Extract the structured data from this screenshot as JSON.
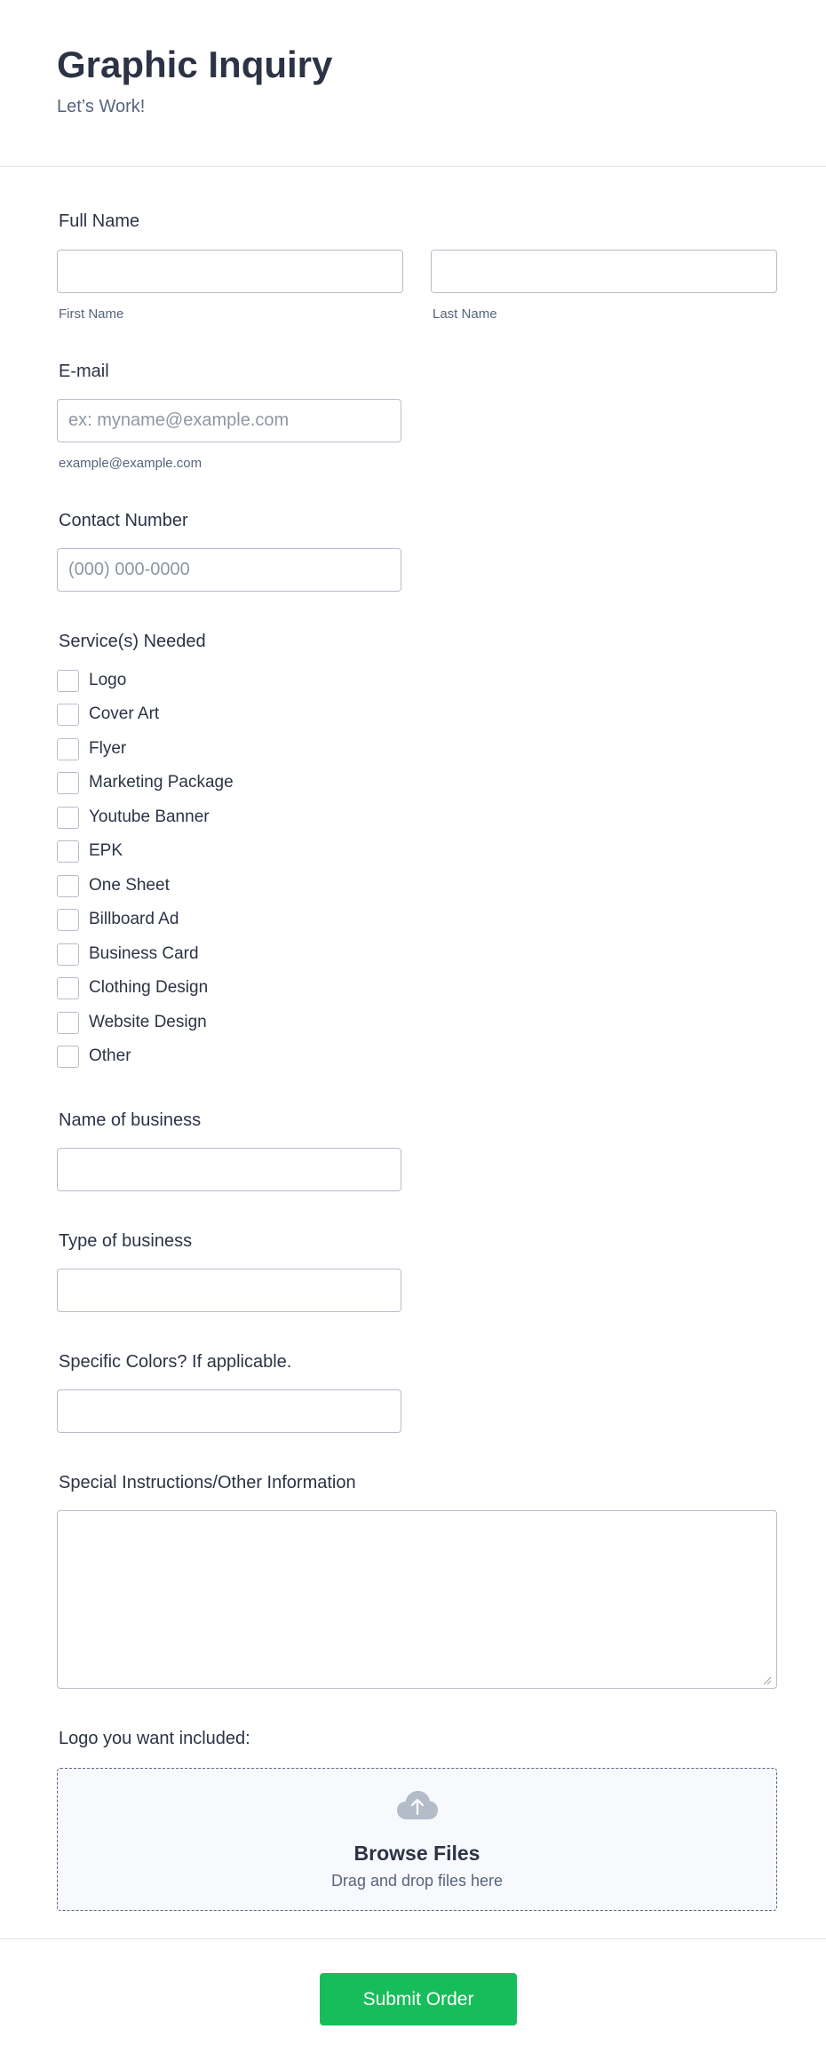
{
  "header": {
    "title": "Graphic Inquiry",
    "subtitle": "Let’s Work!"
  },
  "full_name": {
    "label": "Full Name",
    "first_sublabel": "First Name",
    "last_sublabel": "Last Name",
    "first_value": "",
    "last_value": ""
  },
  "email": {
    "label": "E-mail",
    "placeholder": "ex: myname@example.com",
    "sublabel": "example@example.com",
    "value": ""
  },
  "contact": {
    "label": "Contact Number",
    "placeholder": "(000) 000-0000",
    "value": ""
  },
  "services": {
    "label": "Service(s) Needed",
    "options": [
      {
        "label": "Logo",
        "checked": false
      },
      {
        "label": "Cover Art",
        "checked": false
      },
      {
        "label": "Flyer",
        "checked": false
      },
      {
        "label": "Marketing Package",
        "checked": false
      },
      {
        "label": "Youtube Banner",
        "checked": false
      },
      {
        "label": "EPK",
        "checked": false
      },
      {
        "label": "One Sheet",
        "checked": false
      },
      {
        "label": "Billboard Ad",
        "checked": false
      },
      {
        "label": "Business Card",
        "checked": false
      },
      {
        "label": "Clothing Design",
        "checked": false
      },
      {
        "label": "Website Design",
        "checked": false
      },
      {
        "label": "Other",
        "checked": false
      }
    ]
  },
  "business_name": {
    "label": "Name of business",
    "value": ""
  },
  "business_type": {
    "label": "Type of business",
    "value": ""
  },
  "colors": {
    "label": "Specific Colors? If applicable.",
    "value": ""
  },
  "instructions": {
    "label": "Special Instructions/Other Information",
    "value": ""
  },
  "upload": {
    "label": "Logo you want included:",
    "title": "Browse Files",
    "hint": "Drag and drop files here",
    "icon": "cloud-upload-icon"
  },
  "submit": {
    "label": "Submit Order"
  },
  "colors_theme": {
    "accent": "#18bd5b",
    "text": "#2c3345",
    "muted": "#57647e",
    "border": "#b8bdc9"
  }
}
